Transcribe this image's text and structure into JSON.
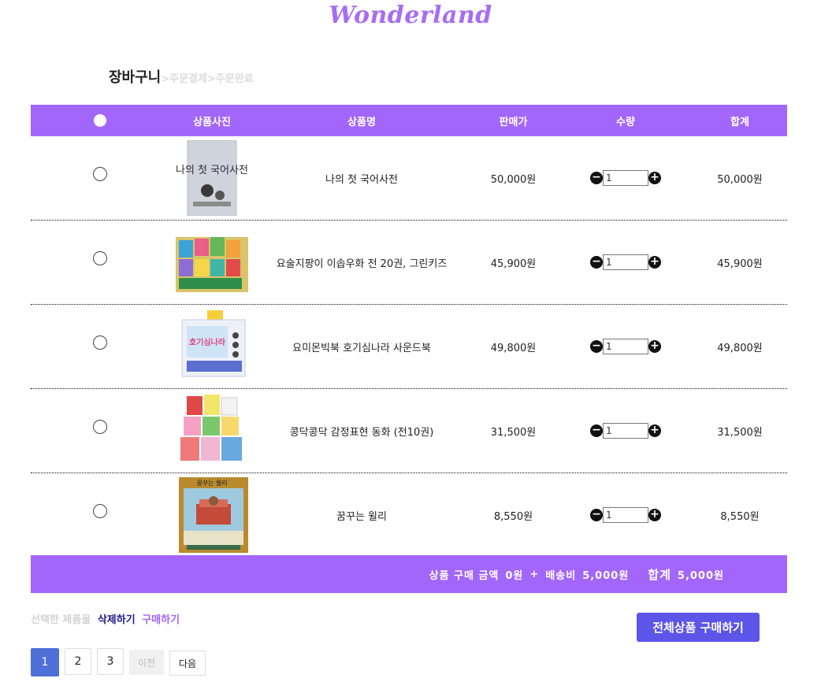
{
  "logo": "Wonderland",
  "breadcrumb": {
    "current": "장바구니",
    "rest": ">주문결제>주문완료"
  },
  "table": {
    "headers": {
      "image": "상품사진",
      "name": "상품명",
      "price": "판매가",
      "qty": "수량",
      "total": "합계"
    },
    "rows": [
      {
        "name": "나의 첫 국어사전",
        "price": "50,000원",
        "qty": "1",
        "total": "50,000원"
      },
      {
        "name": "요술지팡이 이솝우화 전 20권, 그린키즈",
        "price": "45,900원",
        "qty": "1",
        "total": "45,900원"
      },
      {
        "name": "요미몬빅북 호기심나라 사운드북",
        "price": "49,800원",
        "qty": "1",
        "total": "49,800원"
      },
      {
        "name": "콩닥콩닥 감정표현 동화 (전10권)",
        "price": "31,500원",
        "qty": "1",
        "total": "31,500원"
      },
      {
        "name": "꿈꾸는 윌리",
        "price": "8,550원",
        "qty": "1",
        "total": "8,550원"
      }
    ]
  },
  "summary": {
    "purchase_label": "상품 구매 금액",
    "purchase_amount": "0원",
    "plus": "+",
    "shipping_label": "배송비",
    "shipping_amount": "5,000원",
    "total_label": "합계",
    "total_amount": "5,000원"
  },
  "actions": {
    "selected_label": "선택한 제품을",
    "delete": "삭제하기",
    "buy": "구매하기"
  },
  "buy_all": "전체상품 구매하기",
  "pagination": {
    "pages": [
      "1",
      "2",
      "3"
    ],
    "prev": "이전",
    "next": "다음",
    "active": "1"
  },
  "qty_buttons": {
    "minus": "−",
    "plus": "+"
  },
  "book_covers": {
    "row1": "나의 첫 국어사전",
    "row3": "호기심나라",
    "row5": "꿈꾸는 윌리"
  },
  "colors": {
    "accent": "#a366fb",
    "logo": "#a86cf2",
    "buy_all": "#5d55e8",
    "page_active": "#4f6fd9",
    "delete_link": "#1c1c8c"
  }
}
